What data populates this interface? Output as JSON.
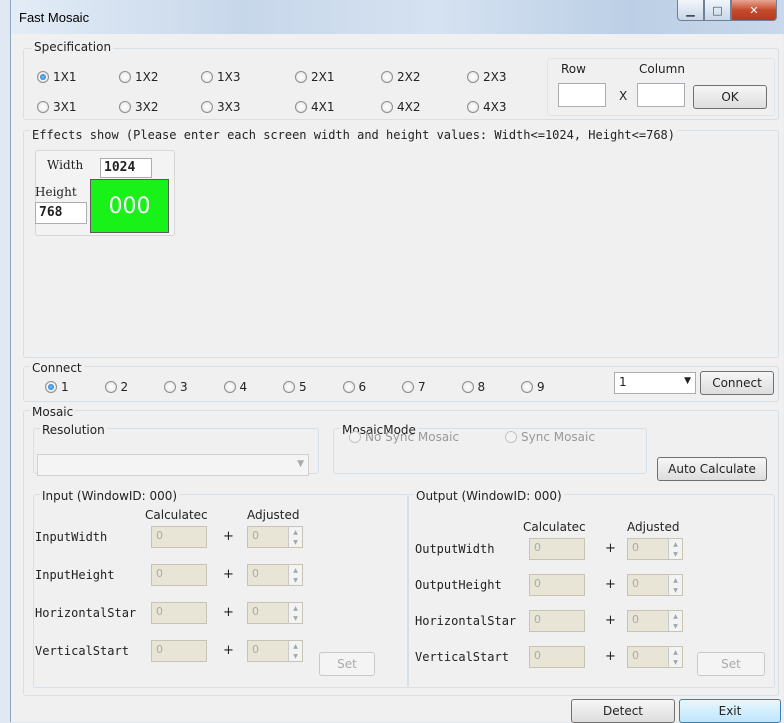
{
  "window": {
    "title": "Fast Mosaic",
    "min_glyph": "▁",
    "max_glyph": "□",
    "close_glyph": "✕"
  },
  "specification": {
    "title": "Specification",
    "options": [
      "1X1",
      "1X2",
      "1X3",
      "2X1",
      "2X2",
      "2X3",
      "3X1",
      "3X2",
      "3X3",
      "4X1",
      "4X2",
      "4X3"
    ],
    "selected": "1X1",
    "row_label": "Row",
    "column_label": "Column",
    "times": "X",
    "row_value": "",
    "column_value": "",
    "ok_label": "OK"
  },
  "effects": {
    "title": "Effects show (Please enter each screen width and height values: Width<=1024, Height<=768)",
    "width_label": "Width",
    "width_value": "1024",
    "height_label": "Height",
    "height_value": "768",
    "screen_label": "000",
    "screen_color": "#19f219"
  },
  "connect": {
    "title": "Connect",
    "options": [
      "1",
      "2",
      "3",
      "4",
      "5",
      "6",
      "7",
      "8",
      "9"
    ],
    "selected": "1",
    "dropdown_value": "1",
    "connect_label": "Connect"
  },
  "mosaic": {
    "title": "Mosaic",
    "resolution_title": "Resolution",
    "resolution_value": "",
    "mode_title": "MosaicMode",
    "no_sync_label": "No Sync Mosaic",
    "sync_label": "Sync Mosaic",
    "auto_calc_label": "Auto Calculate",
    "input": {
      "title": "Input (WindowID: 000)",
      "calc_header": "Calculatec",
      "adj_header": "Adjusted",
      "rows": [
        {
          "label": "InputWidth",
          "calc": "0",
          "adj": "0"
        },
        {
          "label": "InputHeight",
          "calc": "0",
          "adj": "0"
        },
        {
          "label": "HorizontalStar",
          "calc": "0",
          "adj": "0"
        },
        {
          "label": "VerticalStart",
          "calc": "0",
          "adj": "0"
        }
      ],
      "plus": "+",
      "set_label": "Set"
    },
    "output": {
      "title": "Output (WindowID: 000)",
      "calc_header": "Calculatec",
      "adj_header": "Adjusted",
      "rows": [
        {
          "label": "OutputWidth",
          "calc": "0",
          "adj": "0"
        },
        {
          "label": "OutputHeight",
          "calc": "0",
          "adj": "0"
        },
        {
          "label": "HorizontalStar",
          "calc": "0",
          "adj": "0"
        },
        {
          "label": "VerticalStart",
          "calc": "0",
          "adj": "0"
        }
      ],
      "plus": "+",
      "set_label": "Set"
    }
  },
  "footer": {
    "detect_label": "Detect",
    "exit_label": "Exit"
  }
}
